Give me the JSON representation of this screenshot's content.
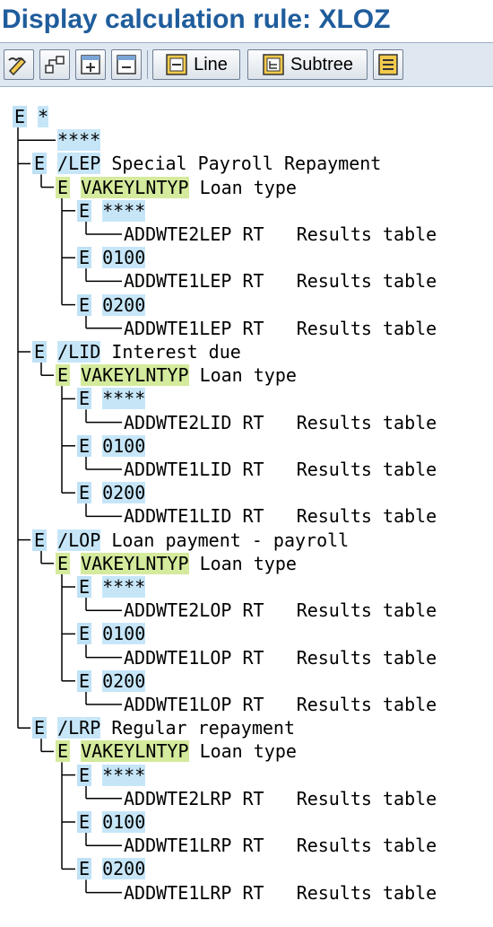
{
  "window": {
    "title": "Display calculation rule: XLOZ"
  },
  "toolbar": {
    "line_label": "Line",
    "subtree_label": "Subtree"
  },
  "tree": {
    "root": {
      "icon": "E",
      "key": "*"
    },
    "root_child": {
      "key": "****"
    },
    "groups": [
      {
        "icon": "E",
        "key": "/LEP",
        "text": "Special Payroll Repayment",
        "sub": {
          "icon": "E",
          "key": "VAKEYLNTYP",
          "text": "Loan type"
        },
        "leaves": [
          {
            "icon": "E",
            "key": "****",
            "op": "ADDWTE2LEP",
            "tbl": "RT",
            "desc": "Results table"
          },
          {
            "icon": "E",
            "key": "0100",
            "op": "ADDWTE1LEP",
            "tbl": "RT",
            "desc": "Results table"
          },
          {
            "icon": "E",
            "key": "0200",
            "op": "ADDWTE1LEP",
            "tbl": "RT",
            "desc": "Results table"
          }
        ]
      },
      {
        "icon": "E",
        "key": "/LID",
        "text": "Interest due",
        "sub": {
          "icon": "E",
          "key": "VAKEYLNTYP",
          "text": "Loan type"
        },
        "leaves": [
          {
            "icon": "E",
            "key": "****",
            "op": "ADDWTE2LID",
            "tbl": "RT",
            "desc": "Results table"
          },
          {
            "icon": "E",
            "key": "0100",
            "op": "ADDWTE1LID",
            "tbl": "RT",
            "desc": "Results table"
          },
          {
            "icon": "E",
            "key": "0200",
            "op": "ADDWTE1LID",
            "tbl": "RT",
            "desc": "Results table"
          }
        ]
      },
      {
        "icon": "E",
        "key": "/LOP",
        "text": "Loan payment - payroll",
        "sub": {
          "icon": "E",
          "key": "VAKEYLNTYP",
          "text": "Loan type"
        },
        "leaves": [
          {
            "icon": "E",
            "key": "****",
            "op": "ADDWTE2LOP",
            "tbl": "RT",
            "desc": "Results table"
          },
          {
            "icon": "E",
            "key": "0100",
            "op": "ADDWTE1LOP",
            "tbl": "RT",
            "desc": "Results table"
          },
          {
            "icon": "E",
            "key": "0200",
            "op": "ADDWTE1LOP",
            "tbl": "RT",
            "desc": "Results table"
          }
        ]
      },
      {
        "icon": "E",
        "key": "/LRP",
        "text": "Regular repayment",
        "sub": {
          "icon": "E",
          "key": "VAKEYLNTYP",
          "text": "Loan type"
        },
        "leaves": [
          {
            "icon": "E",
            "key": "****",
            "op": "ADDWTE2LRP",
            "tbl": "RT",
            "desc": "Results table"
          },
          {
            "icon": "E",
            "key": "0100",
            "op": "ADDWTE1LRP",
            "tbl": "RT",
            "desc": "Results table"
          },
          {
            "icon": "E",
            "key": "0200",
            "op": "ADDWTE1LRP",
            "tbl": "RT",
            "desc": "Results table"
          }
        ]
      }
    ]
  }
}
